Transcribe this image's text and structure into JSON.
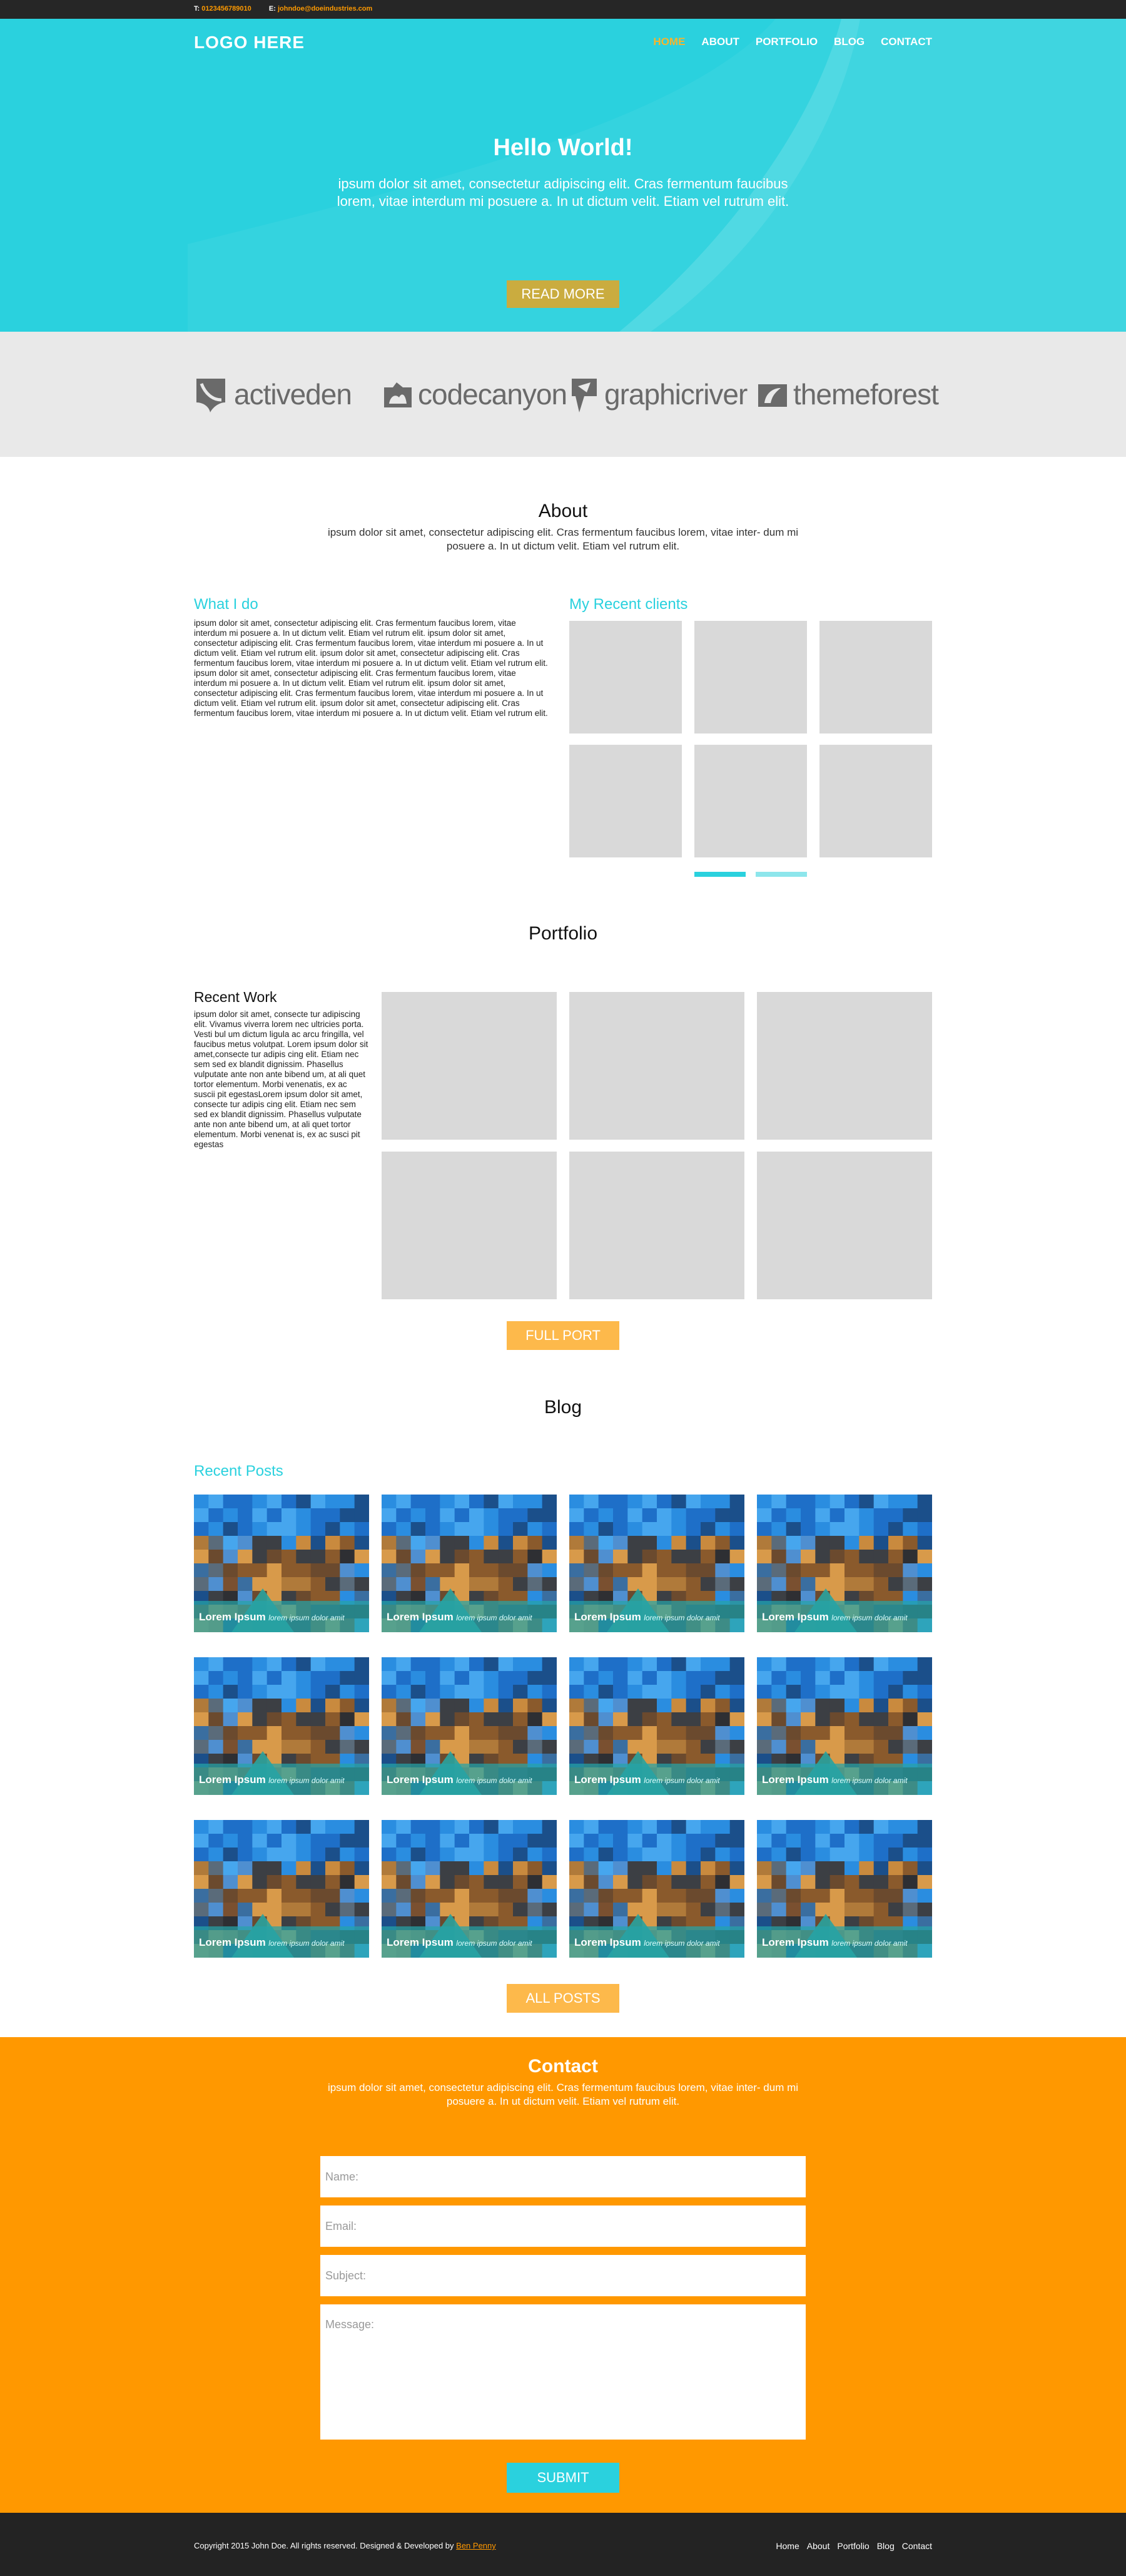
{
  "topbar": {
    "phone_label": "T:",
    "phone": "0123456789010",
    "email_label": "E:",
    "email": "johndoe@doeindustries.com"
  },
  "header": {
    "logo": "LOGO HERE",
    "nav": [
      {
        "label": "HOME",
        "active": true
      },
      {
        "label": "ABOUT",
        "active": false
      },
      {
        "label": "PORTFOLIO",
        "active": false
      },
      {
        "label": "BLOG",
        "active": false
      },
      {
        "label": "CONTACT",
        "active": false
      }
    ]
  },
  "hero": {
    "title": "Hello World!",
    "text": "ipsum dolor sit amet, consectetur adipiscing elit. Cras fermentum faucibus lorem, vitae interdum mi posuere a. In ut dictum velit. Etiam vel rutrum elit.",
    "button": "READ MORE",
    "colors": {
      "background": "#2ad1de",
      "button": "#caac3f",
      "active_nav": "#f7b42c"
    }
  },
  "brands": [
    "activeden",
    "codecanyon",
    "graphicriver",
    "themeforest"
  ],
  "about": {
    "title": "About",
    "subtitle": "ipsum dolor sit amet, consectetur adipiscing elit. Cras fermentum faucibus lorem, vitae inter- dum mi posuere a. In ut dictum velit. Etiam vel rutrum elit.",
    "what_title": "What I do",
    "what_text": "ipsum dolor sit amet, consectetur adipiscing elit. Cras fermentum faucibus lorem, vitae interdum mi posuere a. In ut dictum velit. Etiam vel rutrum elit. ipsum dolor sit amet, consectetur adipiscing elit. Cras fermentum faucibus lorem, vitae interdum mi posuere a. In ut dictum velit. Etiam vel rutrum elit. ipsum dolor sit amet, consectetur adipiscing elit. Cras fermentum faucibus lorem, vitae interdum mi posuere a. In ut dictum velit. Etiam vel rutrum elit. ipsum dolor sit amet, consectetur adipiscing elit. Cras fermentum faucibus lorem, vitae interdum mi posuere a. In ut dictum velit. Etiam vel rutrum elit. ipsum dolor sit amet, consectetur adipiscing elit. Cras fermentum faucibus lorem, vitae interdum mi posuere a. In ut dictum velit. Etiam vel rutrum elit. ipsum dolor sit amet, consectetur adipiscing elit. Cras fermentum faucibus lorem, vitae interdum mi posuere a. In ut dictum velit. Etiam vel rutrum elit.",
    "clients_title": "My Recent clients"
  },
  "portfolio": {
    "title": "Portfolio",
    "recent_title": "Recent Work",
    "recent_text": "ipsum dolor sit amet, consecte tur adipiscing elit. Vivamus viverra lorem nec ultricies porta. Vesti bul um dictum ligula ac arcu fringilla, vel faucibus metus volutpat. Lorem ipsum dolor sit amet,consecte tur adipis cing elit. Etiam nec sem sed ex blandit dignissim. Phasellus vulputate ante non ante bibend um, at ali quet tortor elementum. Morbi venenatis, ex ac suscii pit egestasLorem ipsum dolor sit amet, consecte tur adipis cing elit. Etiam nec sem sed ex blandit dignissim. Phasellus vulputate ante non ante bibend um, at ali quet tortor elementum. Morbi venenat is, ex ac susci pit egestas",
    "button": "FULL PORT"
  },
  "blog": {
    "title": "Blog",
    "recent_title": "Recent Posts",
    "post_title": "Lorem Ipsum",
    "post_sub": "lorem ipsum dolor amit",
    "button": "ALL POSTS"
  },
  "contact": {
    "title": "Contact",
    "subtitle": "ipsum dolor sit amet, consectetur adipiscing elit. Cras fermentum faucibus lorem, vitae inter- dum mi posuere a. In ut dictum velit. Etiam vel rutrum elit.",
    "name_placeholder": "Name:",
    "email_placeholder": "Email:",
    "subject_placeholder": "Subject:",
    "message_placeholder": "Message:",
    "submit": "SUBMIT",
    "colors": {
      "background": "#ff9800",
      "submit": "#2ad1de"
    }
  },
  "footer": {
    "copyright": "Copyright 2015 John Doe. All rights reserved. Designed & Developed by",
    "author": "Ben Penny",
    "nav": [
      "Home",
      "About",
      "Portfolio",
      "Blog",
      "Contact"
    ]
  }
}
